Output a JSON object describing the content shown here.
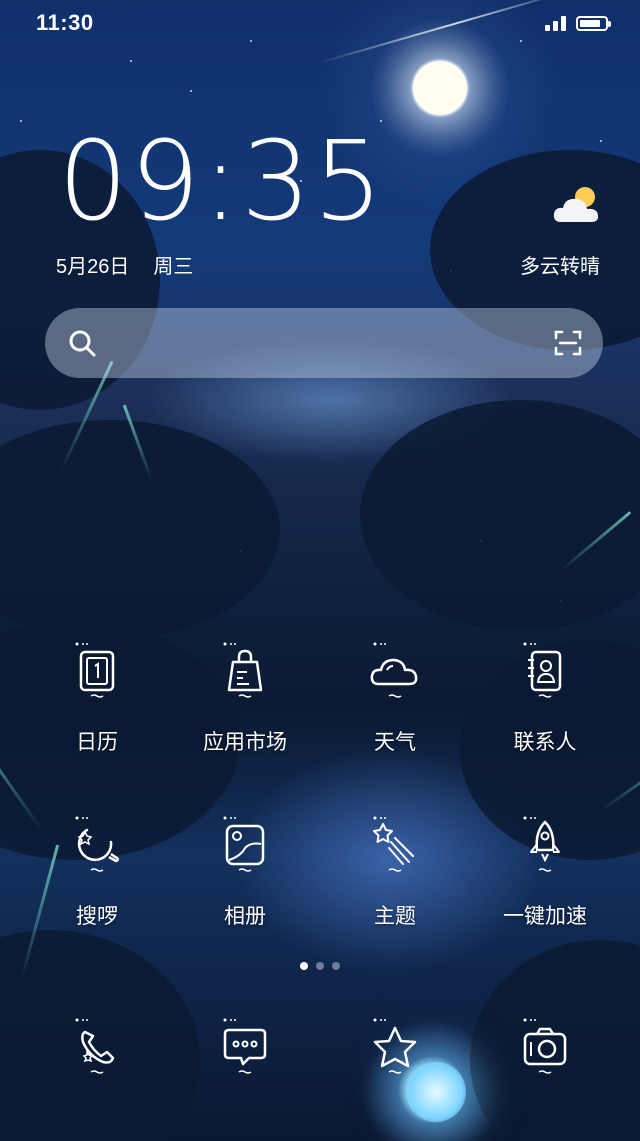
{
  "status_bar": {
    "time": "11:30",
    "icons": [
      "signal-icon",
      "battery-icon"
    ],
    "battery_level": 0.85
  },
  "clock": {
    "time": "09:35",
    "date": "5月26日",
    "weekday": "周三"
  },
  "weather": {
    "description": "多云转晴",
    "icon": "partly-cloudy-icon"
  },
  "search": {
    "value": "",
    "placeholder": "",
    "icons": [
      "search-icon",
      "scan-icon"
    ]
  },
  "apps": {
    "row1": [
      {
        "label": "日历",
        "icon": "calendar-icon"
      },
      {
        "label": "应用市场",
        "icon": "shopping-bag-icon"
      },
      {
        "label": "天气",
        "icon": "cloud-icon"
      },
      {
        "label": "联系人",
        "icon": "contacts-icon"
      }
    ],
    "row2": [
      {
        "label": "搜啰",
        "icon": "search-moon-icon"
      },
      {
        "label": "相册",
        "icon": "gallery-icon"
      },
      {
        "label": "主题",
        "icon": "shooting-star-icon"
      },
      {
        "label": "一键加速",
        "icon": "rocket-icon"
      }
    ],
    "dock": [
      {
        "icon": "phone-icon"
      },
      {
        "icon": "message-icon"
      },
      {
        "icon": "star-icon"
      },
      {
        "icon": "camera-icon"
      }
    ]
  },
  "page_indicator": {
    "current": 1,
    "total": 3
  },
  "colors": {
    "text": "#ffffff",
    "search_bar": "#c8d7eb",
    "sky": "#143a7a"
  }
}
